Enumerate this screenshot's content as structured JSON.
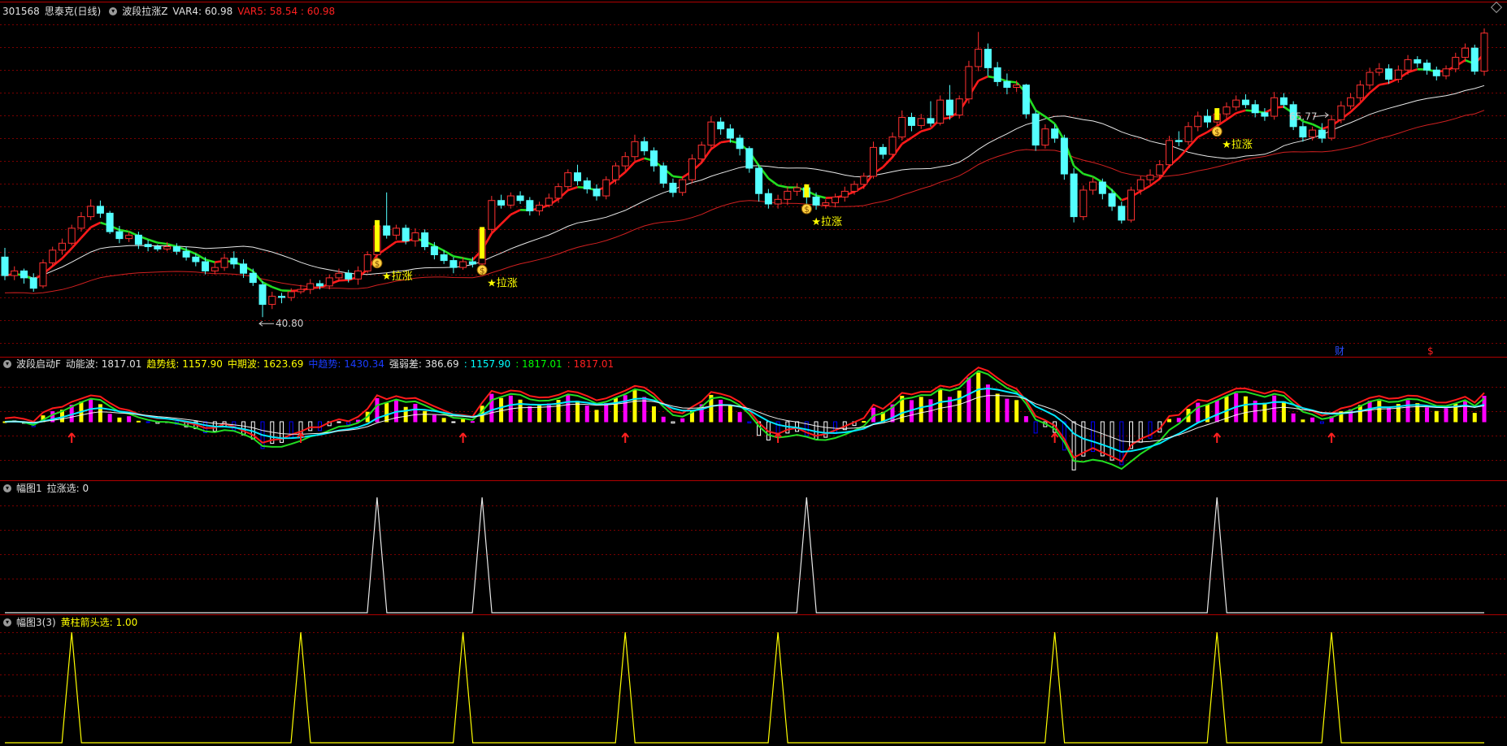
{
  "colors": {
    "bg": "#000000",
    "grid": "#7a0000",
    "up": "#ff3030",
    "down": "#54ffff",
    "yellow": "#ffff00",
    "green": "#00e000",
    "white": "#e0e0e0",
    "magenta": "#ff00ff",
    "blue": "#0000ff",
    "cyan": "#00ffff"
  },
  "main": {
    "code": "301568",
    "name": "思泰克(日线)",
    "indicator": "波段拉涨Z",
    "var4_label": "VAR4: 60.98",
    "var5_label": "VAR5: 58.54 : 60.98",
    "high_label": "65.77",
    "low_label": "40.80",
    "signal_label": "★拉涨",
    "cai_label": "财",
    "dollar_label": "$",
    "coin_icon": "money-bag-icon"
  },
  "osc": {
    "name": "波段启动F",
    "dnb_label": "动能波: 1817.01",
    "qsx_label": "趋势线: 1157.90",
    "zqb_label": "中期波: 1623.69",
    "sqs_label": "中趋势: 1430.34",
    "qrc_label": "强弱差: 386.69",
    "v1_label": ": 1157.90",
    "v2_label": ": 1817.01",
    "v3_label": ": 1817.01"
  },
  "p3": {
    "name": "幅图1",
    "value_label": "拉涨选: 0"
  },
  "p4": {
    "name": "幅图3(3)",
    "value_label": "黄柱箭头选: 1.00"
  },
  "chart_data": [
    {
      "type": "candlestick",
      "title": "301568 思泰克(日线)",
      "ylim": [
        38,
        67
      ],
      "annotations": [
        {
          "text": "65.77",
          "at_index": 139
        },
        {
          "text": "40.80",
          "at_index": 27
        },
        {
          "text": "★拉涨",
          "at_index": 39
        },
        {
          "text": "★拉涨",
          "at_index": 50
        },
        {
          "text": "★拉涨",
          "at_index": 84
        },
        {
          "text": "★拉涨",
          "at_index": 127
        }
      ],
      "series": [
        {
          "values": [
            [
              46.0,
              44.4,
              46.8,
              44.0
            ],
            [
              44.4,
              44.8,
              45.2,
              44.0
            ],
            [
              44.8,
              44.2,
              45.0,
              43.7
            ],
            [
              44.2,
              43.3,
              44.6,
              43.0
            ],
            [
              43.5,
              45.5,
              45.8,
              43.3
            ],
            [
              45.5,
              46.6,
              46.9,
              45.2
            ],
            [
              46.6,
              47.2,
              47.6,
              46.2
            ],
            [
              47.2,
              48.5,
              48.8,
              47.0
            ],
            [
              48.5,
              49.5,
              49.9,
              48.2
            ],
            [
              49.5,
              50.4,
              51.0,
              49.2
            ],
            [
              50.4,
              49.8,
              50.9,
              49.4
            ],
            [
              49.8,
              48.2,
              50.0,
              48.0
            ],
            [
              48.2,
              47.6,
              48.7,
              47.2
            ],
            [
              47.6,
              47.9,
              48.2,
              47.3
            ],
            [
              47.9,
              47.1,
              48.2,
              46.7
            ],
            [
              47.1,
              46.9,
              47.5,
              46.5
            ],
            [
              46.9,
              46.7,
              47.1,
              46.5
            ],
            [
              46.7,
              46.9,
              47.3,
              46.5
            ],
            [
              46.9,
              46.5,
              47.2,
              46.2
            ],
            [
              46.5,
              46.0,
              46.9,
              45.7
            ],
            [
              46.0,
              45.6,
              46.3,
              45.2
            ],
            [
              45.6,
              44.8,
              46.0,
              44.5
            ],
            [
              44.8,
              45.1,
              45.5,
              44.5
            ],
            [
              45.1,
              45.9,
              46.3,
              44.8
            ],
            [
              45.9,
              45.4,
              46.5,
              45.0
            ],
            [
              45.4,
              44.6,
              45.8,
              44.2
            ],
            [
              44.6,
              43.8,
              45.0,
              43.5
            ],
            [
              43.6,
              41.9,
              43.9,
              40.8
            ],
            [
              41.9,
              42.6,
              43.0,
              41.5
            ],
            [
              42.6,
              42.5,
              42.9,
              42.0
            ],
            [
              42.5,
              43.0,
              43.3,
              42.2
            ],
            [
              43.0,
              43.2,
              43.6,
              42.8
            ],
            [
              43.2,
              43.7,
              44.1,
              42.8
            ],
            [
              43.7,
              43.5,
              44.0,
              43.2
            ],
            [
              43.5,
              44.2,
              44.5,
              43.2
            ],
            [
              44.2,
              44.6,
              45.0,
              43.9
            ],
            [
              44.6,
              44.1,
              44.9,
              43.8
            ],
            [
              44.1,
              44.8,
              45.2,
              43.6
            ],
            [
              44.8,
              46.2,
              46.5,
              44.6
            ],
            [
              46.2,
              48.7,
              49.2,
              45.9
            ],
            [
              48.7,
              47.9,
              51.6,
              47.6
            ],
            [
              47.9,
              48.5,
              48.8,
              47.5
            ],
            [
              48.5,
              47.4,
              48.8,
              47.1
            ],
            [
              47.4,
              48.1,
              48.5,
              46.9
            ],
            [
              48.1,
              46.9,
              48.4,
              46.6
            ],
            [
              46.9,
              46.2,
              47.3,
              45.8
            ],
            [
              46.2,
              45.7,
              46.6,
              45.4
            ],
            [
              45.7,
              45.1,
              46.0,
              44.6
            ],
            [
              45.1,
              45.6,
              46.0,
              44.9
            ],
            [
              45.6,
              45.4,
              46.0,
              45.1
            ],
            [
              45.4,
              48.4,
              48.6,
              45.3
            ],
            [
              48.4,
              50.9,
              51.3,
              48.1
            ],
            [
              50.9,
              50.5,
              51.4,
              50.2
            ],
            [
              50.5,
              51.3,
              51.6,
              50.2
            ],
            [
              51.3,
              50.9,
              51.7,
              50.6
            ],
            [
              50.9,
              50.0,
              51.2,
              49.6
            ],
            [
              50.0,
              50.5,
              50.8,
              49.6
            ],
            [
              50.5,
              51.1,
              51.5,
              50.3
            ],
            [
              51.1,
              52.1,
              52.4,
              50.7
            ],
            [
              52.1,
              53.3,
              53.6,
              51.8
            ],
            [
              53.3,
              52.6,
              54.0,
              52.2
            ],
            [
              52.6,
              51.9,
              52.9,
              51.5
            ],
            [
              51.9,
              51.3,
              52.3,
              50.9
            ],
            [
              51.3,
              52.7,
              53.0,
              51.0
            ],
            [
              52.7,
              53.9,
              54.2,
              52.3
            ],
            [
              53.9,
              54.7,
              55.1,
              53.5
            ],
            [
              54.7,
              56.0,
              56.6,
              54.3
            ],
            [
              56.0,
              55.2,
              56.4,
              54.8
            ],
            [
              55.2,
              53.9,
              55.5,
              53.4
            ],
            [
              53.9,
              52.4,
              54.2,
              52.0
            ],
            [
              52.4,
              51.6,
              52.8,
              51.2
            ],
            [
              51.6,
              52.7,
              53.0,
              51.3
            ],
            [
              52.7,
              54.5,
              54.9,
              52.4
            ],
            [
              54.5,
              55.7,
              56.0,
              54.1
            ],
            [
              55.7,
              57.7,
              58.2,
              55.3
            ],
            [
              57.7,
              57.1,
              58.1,
              56.6
            ],
            [
              57.1,
              56.3,
              57.5,
              55.9
            ],
            [
              56.3,
              55.4,
              56.6,
              54.8
            ],
            [
              55.4,
              53.7,
              55.6,
              53.3
            ],
            [
              53.7,
              51.5,
              54.0,
              50.8
            ],
            [
              51.5,
              50.6,
              51.9,
              50.2
            ],
            [
              50.6,
              51.0,
              51.4,
              50.2
            ],
            [
              51.0,
              51.7,
              52.1,
              50.5
            ],
            [
              51.7,
              52.0,
              52.4,
              51.3
            ],
            [
              52.0,
              51.2,
              52.3,
              50.6
            ],
            [
              51.2,
              50.5,
              51.6,
              50.1
            ],
            [
              50.5,
              50.7,
              51.0,
              50.2
            ],
            [
              50.7,
              51.2,
              51.5,
              50.3
            ],
            [
              51.2,
              51.7,
              52.1,
              50.8
            ],
            [
              51.7,
              52.3,
              52.6,
              51.4
            ],
            [
              52.3,
              53.0,
              53.3,
              51.9
            ],
            [
              53.0,
              55.5,
              56.0,
              52.8
            ],
            [
              55.5,
              54.9,
              55.8,
              54.5
            ],
            [
              54.9,
              56.4,
              56.8,
              54.6
            ],
            [
              56.4,
              58.1,
              58.7,
              56.1
            ],
            [
              58.1,
              57.4,
              58.5,
              56.9
            ],
            [
              57.4,
              58.0,
              58.4,
              57.1
            ],
            [
              58.0,
              57.6,
              59.5,
              57.3
            ],
            [
              57.6,
              59.6,
              60.0,
              57.4
            ],
            [
              59.6,
              58.3,
              60.9,
              57.9
            ],
            [
              58.3,
              59.7,
              60.0,
              58.0
            ],
            [
              59.7,
              62.5,
              63.0,
              59.3
            ],
            [
              62.5,
              64.0,
              65.5,
              62.1
            ],
            [
              64.0,
              62.4,
              64.5,
              61.7
            ],
            [
              62.4,
              61.2,
              62.9,
              60.8
            ],
            [
              61.2,
              60.7,
              61.9,
              60.1
            ],
            [
              60.7,
              60.9,
              61.3,
              60.3
            ],
            [
              60.9,
              58.4,
              61.0,
              58.0
            ],
            [
              58.4,
              55.7,
              58.7,
              55.2
            ],
            [
              55.7,
              57.1,
              57.5,
              55.4
            ],
            [
              57.1,
              56.3,
              57.5,
              55.9
            ],
            [
              56.3,
              53.2,
              56.6,
              52.7
            ],
            [
              53.2,
              49.5,
              53.7,
              49.0
            ],
            [
              49.5,
              51.8,
              52.2,
              49.2
            ],
            [
              51.8,
              52.5,
              52.9,
              51.4
            ],
            [
              52.5,
              51.5,
              52.8,
              51.0
            ],
            [
              51.5,
              50.4,
              51.9,
              50.0
            ],
            [
              50.4,
              49.2,
              50.8,
              48.9
            ],
            [
              49.2,
              51.8,
              52.1,
              49.0
            ],
            [
              51.8,
              52.7,
              53.0,
              51.4
            ],
            [
              52.7,
              53.1,
              53.6,
              52.3
            ],
            [
              53.1,
              54.0,
              54.4,
              52.8
            ],
            [
              54.0,
              56.1,
              56.5,
              53.7
            ],
            [
              56.1,
              56.0,
              56.9,
              55.6
            ],
            [
              56.0,
              57.3,
              57.7,
              55.7
            ],
            [
              57.3,
              58.2,
              58.6,
              56.9
            ],
            [
              58.2,
              57.7,
              58.8,
              57.2
            ],
            [
              57.7,
              58.4,
              58.9,
              57.3
            ],
            [
              58.4,
              59.0,
              59.4,
              58.0
            ],
            [
              59.0,
              59.6,
              60.0,
              58.7
            ],
            [
              59.6,
              59.2,
              60.1,
              58.9
            ],
            [
              59.2,
              58.5,
              59.6,
              58.1
            ],
            [
              58.5,
              58.2,
              58.9,
              57.8
            ],
            [
              58.2,
              59.8,
              60.3,
              57.9
            ],
            [
              59.8,
              59.2,
              60.2,
              58.9
            ],
            [
              59.2,
              57.3,
              59.5,
              57.0
            ],
            [
              57.3,
              56.4,
              57.7,
              56.0
            ],
            [
              56.4,
              57.0,
              57.3,
              56.1
            ],
            [
              57.0,
              56.3,
              57.6,
              55.9
            ],
            [
              56.3,
              57.9,
              58.3,
              56.1
            ],
            [
              57.9,
              59.1,
              59.5,
              57.6
            ],
            [
              59.1,
              59.8,
              60.2,
              58.8
            ],
            [
              59.8,
              60.9,
              61.3,
              59.5
            ],
            [
              60.9,
              62.0,
              62.4,
              60.5
            ],
            [
              62.0,
              62.3,
              62.8,
              61.7
            ],
            [
              62.3,
              61.4,
              62.7,
              61.0
            ],
            [
              61.4,
              62.2,
              62.6,
              61.1
            ],
            [
              62.2,
              63.1,
              63.5,
              61.8
            ],
            [
              63.1,
              62.8,
              63.4,
              62.4
            ],
            [
              62.8,
              62.2,
              63.1,
              61.8
            ],
            [
              62.2,
              61.7,
              62.5,
              61.3
            ],
            [
              61.7,
              62.3,
              62.6,
              61.4
            ],
            [
              62.3,
              63.3,
              63.7,
              62.0
            ],
            [
              63.3,
              64.1,
              64.5,
              62.9
            ],
            [
              64.1,
              62.1,
              64.4,
              61.8
            ],
            [
              62.1,
              65.4,
              65.8,
              61.7
            ]
          ]
        }
      ]
    },
    {
      "type": "line",
      "title": "波段启动F",
      "series": [
        {
          "name": "动能波",
          "values": [
            1817.01
          ]
        },
        {
          "name": "趋势线",
          "values": [
            1157.9
          ]
        },
        {
          "name": "中期波",
          "values": [
            1623.69
          ]
        },
        {
          "name": "中趋势",
          "values": [
            1430.34
          ]
        },
        {
          "name": "强弱差",
          "values": [
            386.69
          ]
        }
      ]
    },
    {
      "type": "line",
      "title": "幅图1",
      "series": [
        {
          "name": "拉涨选",
          "values": [
            0
          ]
        }
      ],
      "peaks_at_index": [
        39,
        50,
        84,
        127
      ]
    },
    {
      "type": "line",
      "title": "幅图3(3)",
      "series": [
        {
          "name": "黄柱箭头选",
          "values": [
            1.0
          ]
        }
      ],
      "peaks_at_index": [
        7,
        31,
        48,
        65,
        81,
        110,
        127,
        139
      ]
    }
  ]
}
